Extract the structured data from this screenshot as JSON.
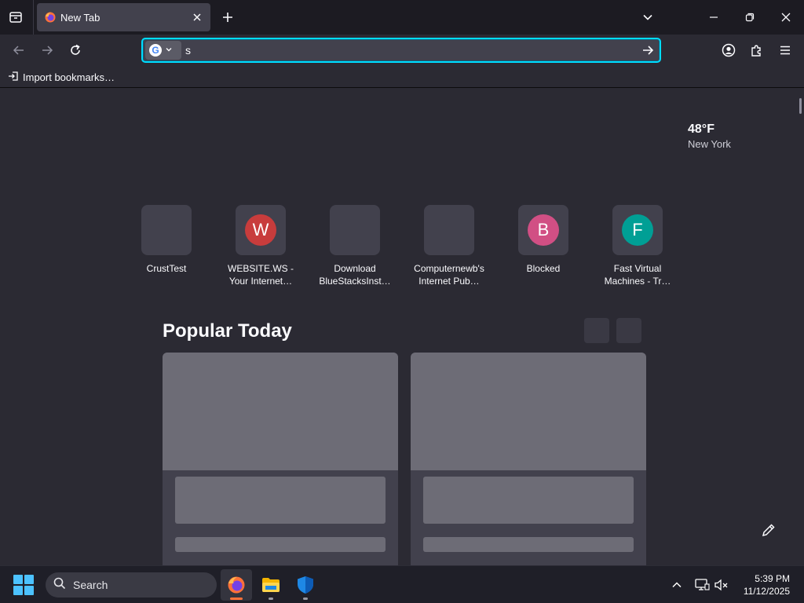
{
  "colors": {
    "accent": "#00ddff",
    "site_w": "#c83c3c",
    "site_b": "#d14f84",
    "site_f": "#009f95",
    "taskbar_accent": "#4cc2ff",
    "firefox_indicator": "#ff7139"
  },
  "tabbar": {
    "tab_list_icon": "tab-list-icon",
    "active_tab": {
      "title": "New Tab",
      "favicon": "firefox-icon"
    },
    "new_tab_icon": "plus-icon",
    "list_all_tabs_icon": "chevron-down-icon",
    "window_controls": [
      "minimize-icon",
      "restore-icon",
      "close-icon"
    ]
  },
  "navbar": {
    "back_icon": "arrow-left-icon",
    "forward_icon": "arrow-right-icon",
    "reload_icon": "reload-icon",
    "search_engine": {
      "letter": "G",
      "icon": "google-icon"
    },
    "url_value": "s",
    "go_icon": "arrow-right-icon",
    "account_icon": "account-icon",
    "extensions_icon": "puzzle-icon",
    "menu_icon": "hamburger-menu-icon"
  },
  "bookmarks": {
    "import_label": "Import bookmarks…"
  },
  "weather": {
    "temperature": "48°F",
    "city": "New York"
  },
  "top_sites": [
    {
      "label_line1": "CrustTest",
      "label_line2": "",
      "letter": ""
    },
    {
      "label_line1": "WEBSITE.WS -",
      "label_line2": "Your Internet…",
      "letter": "W"
    },
    {
      "label_line1": "Download",
      "label_line2": "BlueStacksInst…",
      "letter": ""
    },
    {
      "label_line1": "Computernewb's",
      "label_line2": "Internet Pub…",
      "letter": ""
    },
    {
      "label_line1": "Blocked",
      "label_line2": "",
      "letter": "B"
    },
    {
      "label_line1": "Fast Virtual",
      "label_line2": "Machines - Tr…",
      "letter": "F"
    }
  ],
  "popular": {
    "title": "Popular Today"
  },
  "taskbar": {
    "start_icon": "windows-start-icon",
    "search_label": "Search",
    "apps": [
      "firefox-icon",
      "file-explorer-icon",
      "windows-security-icon"
    ],
    "tray_icons": [
      "chevron-up-icon",
      "network-icon",
      "volume-muted-icon"
    ],
    "time": "5:39 PM",
    "date": "11/12/2025"
  }
}
